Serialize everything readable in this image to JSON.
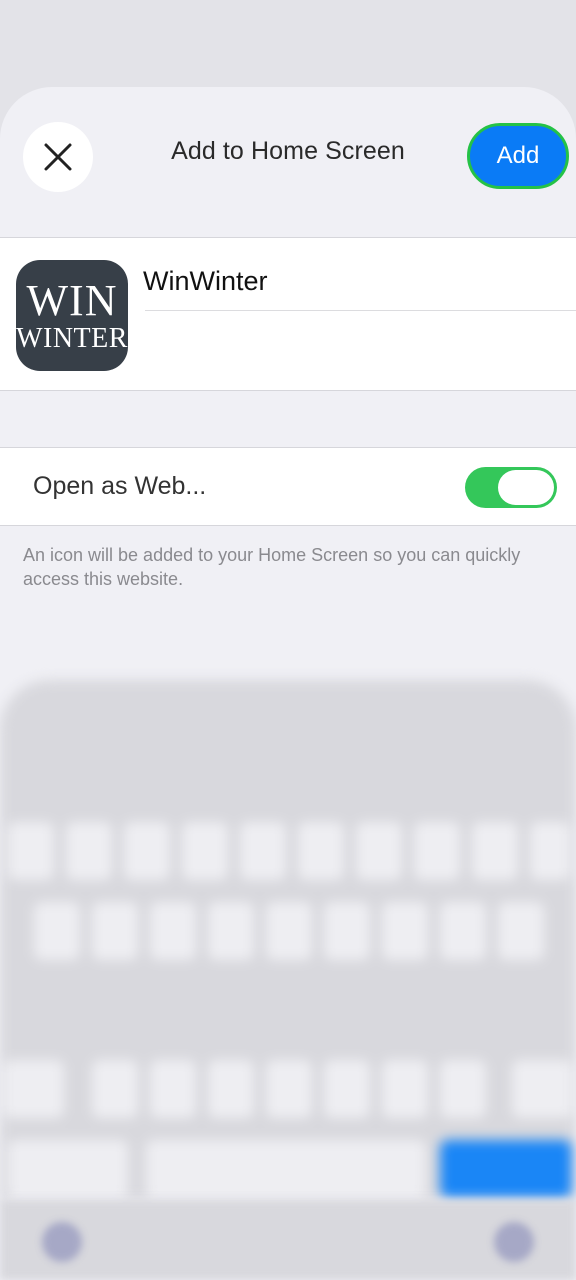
{
  "header": {
    "title": "Add to Home Screen",
    "add_label": "Add",
    "close_icon": "close-icon"
  },
  "app": {
    "icon_line1": "WIN",
    "icon_line2": "WINTER",
    "name": "WinWinter"
  },
  "settings": {
    "open_as_web_label": "Open as Web...",
    "open_as_web_enabled": true
  },
  "footnote": "An icon will be added to your Home Screen so you can quickly access this website.",
  "colors": {
    "accent": "#0a7bf6",
    "toggle_on": "#34c75a",
    "focus_ring": "#25c246"
  }
}
